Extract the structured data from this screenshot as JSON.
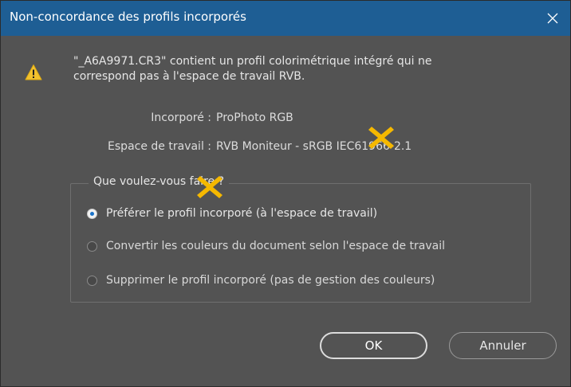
{
  "window": {
    "title": "Non-concordance des profils incorporés"
  },
  "colors": {
    "titlebar": "#1e5e94",
    "background": "#535353",
    "text": "#e6e6e6",
    "radio_accent": "#1a73c9",
    "marker": "#f5b800"
  },
  "icons": {
    "close": "close-icon",
    "warning": "warning-icon",
    "marker": "cross-marker"
  },
  "message": {
    "line1": "\"_A6A9971.CR3\" contient un profil colorimétrique intégré qui ne",
    "line2": "correspond pas à l'espace de travail RVB."
  },
  "info": {
    "embedded_label": "Incorporé :",
    "embedded_value": "ProPhoto RGB",
    "working_label": "Espace de travail :",
    "working_value": "RVB Moniteur - sRGB IEC61966-2.1"
  },
  "options": {
    "legend": "Que voulez-vous faire ?",
    "items": [
      {
        "label": "Préférer le profil incorporé (à l'espace de travail)",
        "selected": true
      },
      {
        "label": "Convertir les couleurs du document selon l'espace de travail",
        "selected": false
      },
      {
        "label": "Supprimer le profil incorporé (pas de gestion des couleurs)",
        "selected": false
      }
    ]
  },
  "buttons": {
    "ok": "OK",
    "cancel": "Annuler"
  }
}
